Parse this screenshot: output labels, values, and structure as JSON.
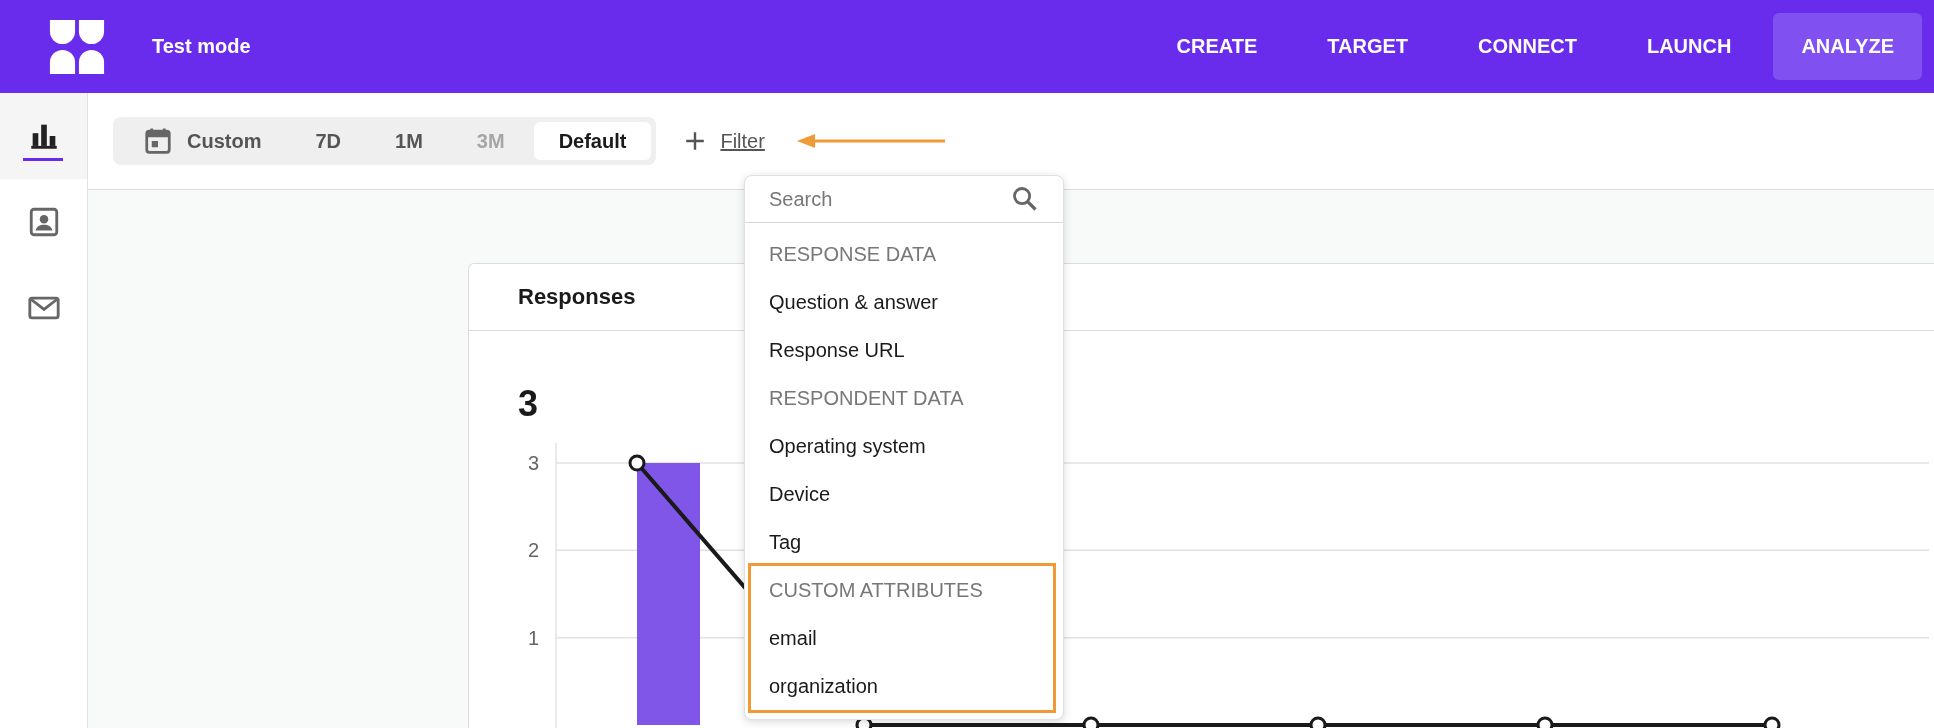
{
  "header": {
    "mode_label": "Test mode",
    "nav": [
      {
        "label": "CREATE",
        "selected": false
      },
      {
        "label": "TARGET",
        "selected": false
      },
      {
        "label": "CONNECT",
        "selected": false
      },
      {
        "label": "LAUNCH",
        "selected": false
      },
      {
        "label": "ANALYZE",
        "selected": true
      }
    ]
  },
  "sidebar": {
    "items": [
      {
        "kind": "chart",
        "selected": true
      },
      {
        "kind": "contact",
        "selected": false
      },
      {
        "kind": "mail",
        "selected": false
      }
    ]
  },
  "date_range": [
    {
      "kind": "custom",
      "label": "Custom",
      "selected": false,
      "disabled": false
    },
    {
      "kind": "preset",
      "label": "7D",
      "selected": false,
      "disabled": false
    },
    {
      "kind": "preset",
      "label": "1M",
      "selected": false,
      "disabled": false
    },
    {
      "kind": "preset",
      "label": "3M",
      "selected": false,
      "disabled": true
    },
    {
      "kind": "preset",
      "label": "Default",
      "selected": true,
      "disabled": false
    }
  ],
  "filter": {
    "label": "Filter",
    "pointer_arrow": true
  },
  "filter_menu": {
    "search": {
      "placeholder": "Search"
    },
    "sections": [
      {
        "title": "RESPONSE DATA",
        "highlighted": false,
        "items": [
          "Question & answer",
          "Response URL"
        ]
      },
      {
        "title": "RESPONDENT DATA",
        "highlighted": false,
        "items": [
          "Operating system",
          "Device",
          "Tag"
        ]
      },
      {
        "title": "CUSTOM ATTRIBUTES",
        "highlighted": true,
        "items": [
          "email",
          "organization"
        ]
      }
    ]
  },
  "card": {
    "title": "Responses",
    "total": "3",
    "chart_data": {
      "type": "bar",
      "ylim": [
        0,
        3
      ],
      "yticks": [
        1,
        2,
        3
      ],
      "series": [
        {
          "type": "bar",
          "color": "#7f56e8",
          "values": [
            3,
            0,
            0,
            0,
            0,
            0
          ]
        },
        {
          "type": "line",
          "color": "#1a1a1a",
          "marker": "o",
          "values": [
            3,
            0,
            0,
            0,
            0,
            0
          ]
        }
      ]
    }
  }
}
